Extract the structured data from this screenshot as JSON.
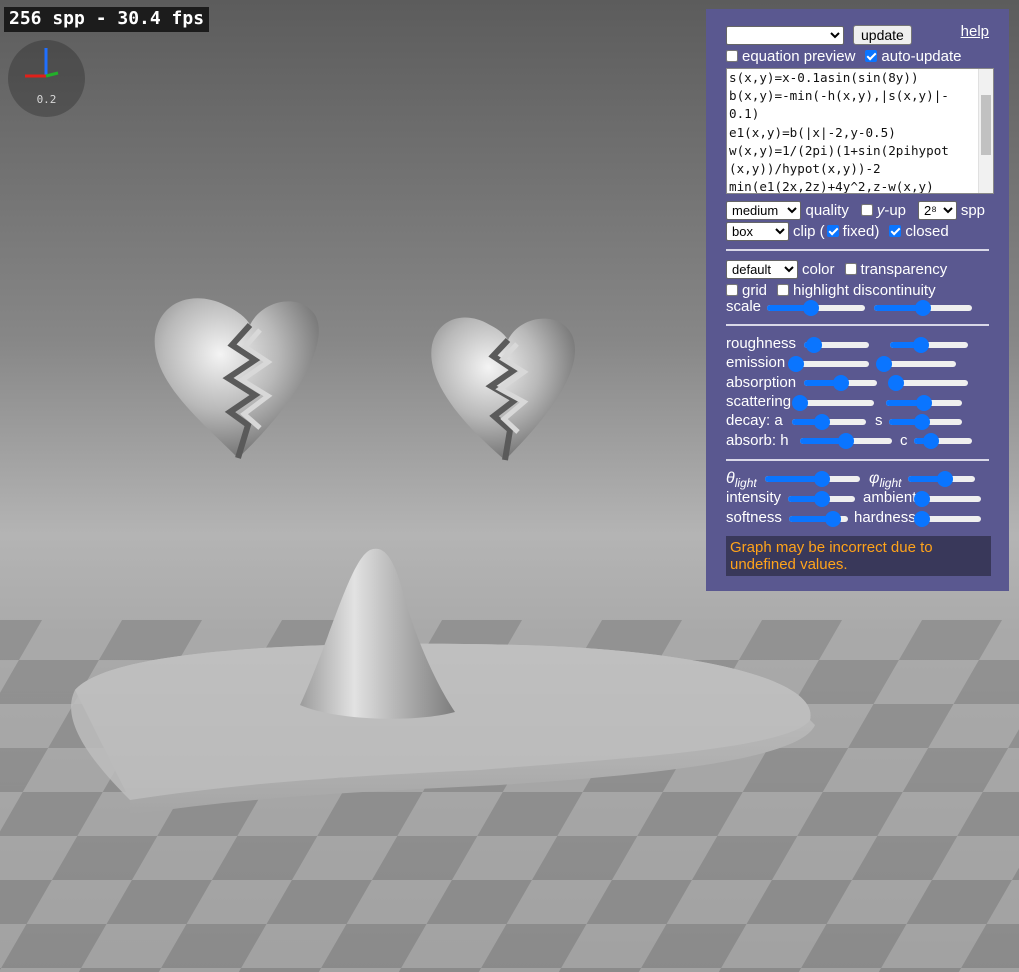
{
  "viewport": {
    "stats": "256 spp - 30.4 fps",
    "axis_scale": "0.2",
    "colors": {
      "x_axis": "#e0201a",
      "y_axis": "#22b02a",
      "z_axis": "#1f6fff",
      "background": "#777777"
    }
  },
  "panel": {
    "preset_select": "",
    "update_label": "update",
    "help_label": "help",
    "equation_preview": {
      "label": "equation preview",
      "checked": false
    },
    "auto_update": {
      "label": "auto-update",
      "checked": true
    },
    "equation_lines": [
      "s(x,y)=x-0.1asin(sin(8y))",
      "b(x,y)=-min(-h(x,y),|s(x,y)|-",
      "0.1)",
      "e1(x,y)=b(|x|-2,y-0.5)",
      "w(x,y)=1/(2pi)(1+sin(2pihypot",
      "(x,y))/hypot(x,y))-2",
      "min(e1(2x,2z)+4y^2,z-w(x,y)"
    ],
    "quality": {
      "value": "medium",
      "label": "quality"
    },
    "y_up": {
      "label_italic": "y",
      "label_rest": "-up",
      "checked": false
    },
    "spp": {
      "value": "2⁸",
      "label": "spp"
    },
    "clip": {
      "value": "box",
      "label_open": "clip (",
      "fixed_label": "fixed)",
      "fixed_checked": true,
      "closed_label": "closed",
      "closed_checked": true
    },
    "color": {
      "value": "default",
      "label": "color"
    },
    "transparency": {
      "label": "transparency",
      "checked": false
    },
    "grid": {
      "label": "grid",
      "checked": false
    },
    "highlight_discontinuity": {
      "label": "highlight discontinuity",
      "checked": false
    },
    "scale": {
      "label": "scale",
      "values": [
        0.45,
        0.5
      ]
    },
    "material": {
      "roughness": {
        "label": "roughness",
        "values": [
          0.15,
          0.4
        ]
      },
      "emission": {
        "label": "emission",
        "values": [
          0.0,
          0.0
        ]
      },
      "absorption": {
        "label": "absorption",
        "values": [
          0.5,
          0.0
        ]
      },
      "scattering": {
        "label": "scattering",
        "values": [
          0.0,
          0.5
        ]
      },
      "decay": {
        "label": "decay: a",
        "label2": "s",
        "values": [
          0.4,
          0.45
        ]
      },
      "absorb": {
        "label": "absorb: h",
        "label2": "c",
        "values": [
          0.5,
          0.3
        ]
      }
    },
    "lighting": {
      "theta": {
        "symbol": "θ",
        "sub": "light",
        "value": 0.6
      },
      "phi": {
        "symbol": "φ",
        "sub": "light",
        "value": 0.55
      },
      "intensity": {
        "label": "intensity",
        "value": 0.5
      },
      "ambient": {
        "label": "ambient",
        "value": 0.0
      },
      "softness": {
        "label": "softness",
        "value": 0.75
      },
      "hardness": {
        "label": "hardness",
        "value": 0.0
      }
    },
    "warning": "Graph may be incorrect due to undefined values.",
    "colors": {
      "panel_bg": "#5a5890",
      "accent": "#0a75ff",
      "warning_text": "#ffa31a",
      "warning_bg": "#39385a"
    }
  }
}
